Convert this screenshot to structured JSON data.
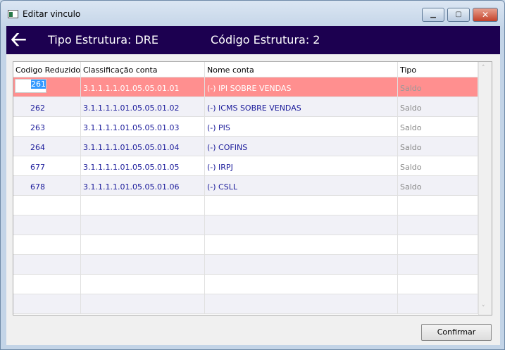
{
  "window": {
    "title": "Editar vinculo",
    "minimize": "▁",
    "maximize": "▢",
    "close": "✕"
  },
  "header": {
    "back_icon": "arrow-left",
    "tipo": "Tipo Estrutura: DRE",
    "codigo": "Código Estrutura: 2"
  },
  "grid": {
    "columns": [
      "Codigo Reduzido",
      "Classificação conta",
      "Nome conta",
      "Tipo"
    ],
    "rows": [
      {
        "codigo": "261",
        "classificacao": "3.1.1.1.1.01.05.05.01.01",
        "nome": "(-) IPI SOBRE VENDAS",
        "tipo": "Saldo"
      },
      {
        "codigo": "262",
        "classificacao": "3.1.1.1.1.01.05.05.01.02",
        "nome": "(-) ICMS SOBRE VENDAS",
        "tipo": "Saldo"
      },
      {
        "codigo": "263",
        "classificacao": "3.1.1.1.1.01.05.05.01.03",
        "nome": "(-) PIS",
        "tipo": "Saldo"
      },
      {
        "codigo": "264",
        "classificacao": "3.1.1.1.1.01.05.05.01.04",
        "nome": "(-) COFINS",
        "tipo": "Saldo"
      },
      {
        "codigo": "677",
        "classificacao": "3.1.1.1.1.01.05.05.01.05",
        "nome": "(-) IRPJ",
        "tipo": "Saldo"
      },
      {
        "codigo": "678",
        "classificacao": "3.1.1.1.1.01.05.05.01.06",
        "nome": "(-) CSLL",
        "tipo": "Saldo"
      }
    ]
  },
  "confirm_label": "Confirmar"
}
